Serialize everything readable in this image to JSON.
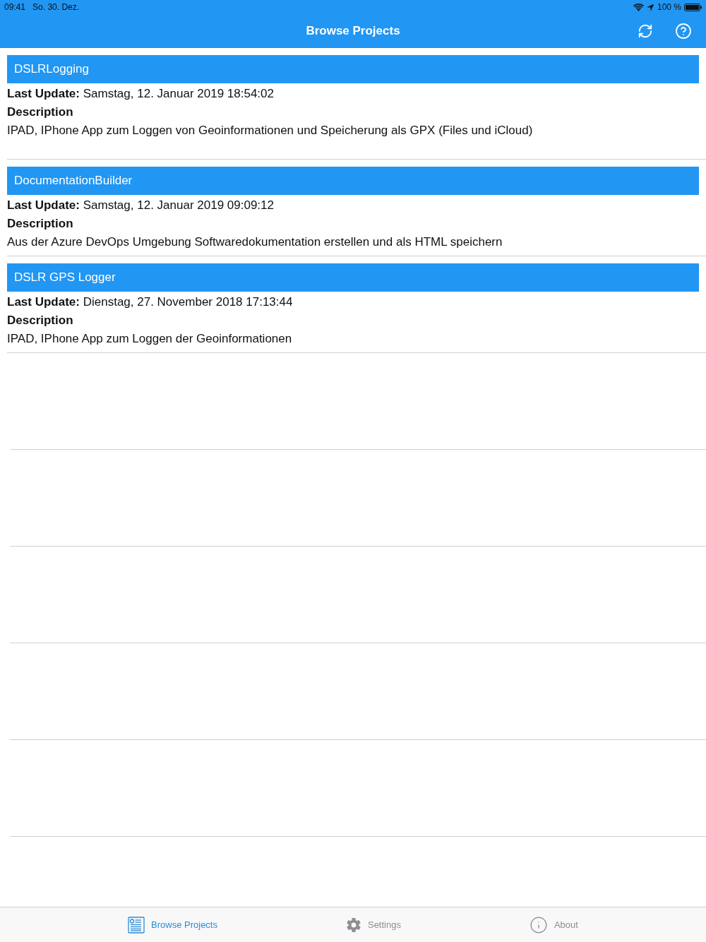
{
  "status_bar": {
    "time": "09:41",
    "date": "So. 30. Dez.",
    "battery": "100 %"
  },
  "nav_bar": {
    "title": "Browse Projects"
  },
  "projects": [
    {
      "name": "DSLRLogging",
      "last_update": "**Last Update:** Samstag, 12. Januar 2019 18:54:02",
      "description_label": "Description",
      "description": "IPAD, IPhone App zum Loggen von Geoinformationen und Speicherung als GPX (Files und iCloud)"
    },
    {
      "name": "DocumentationBuilder",
      "last_update": "**Last Update:** Samstag, 12. Januar 2019 09:09:12",
      "description_label": "Description",
      "description": "Aus der Azure DevOps Umgebung Softwaredokumentation erstellen und als HTML speichern"
    },
    {
      "name": "DSLR GPS Logger",
      "last_update": "**Last Update:** Dienstag, 27. November 2018 17:13:44",
      "description_label": "Description",
      "description": "IPAD, IPhone App zum Loggen der Geoinformationen"
    }
  ],
  "tab_bar": [
    {
      "label": "Browse Projects",
      "selected": true,
      "kind": "browse"
    },
    {
      "label": "Settings",
      "selected": false,
      "kind": "settings"
    },
    {
      "label": "About",
      "selected": false,
      "kind": "about"
    }
  ]
}
